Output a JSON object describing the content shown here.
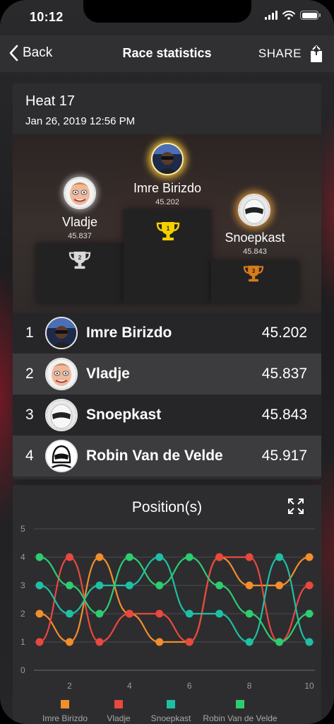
{
  "status": {
    "time": "10:12"
  },
  "nav": {
    "back_label": "Back",
    "title": "Race statistics",
    "share_label": "SHARE"
  },
  "heat": {
    "title": "Heat 17",
    "date": "Jan 26, 2019 12:56 PM"
  },
  "podium": [
    {
      "place": 1,
      "name": "Imre Birizdo",
      "time": "45.202",
      "trophy_color": "#f5d000"
    },
    {
      "place": 2,
      "name": "Vladje",
      "time": "45.837",
      "trophy_color": "#d9d9d9"
    },
    {
      "place": 3,
      "name": "Snoepkast",
      "time": "45.843",
      "trophy_color": "#d67c1c"
    }
  ],
  "ranking": [
    {
      "pos": "1",
      "name": "Imre Birizdo",
      "time": "45.202"
    },
    {
      "pos": "2",
      "name": "Vladje",
      "time": "45.837"
    },
    {
      "pos": "3",
      "name": "Snoepkast",
      "time": "45.843"
    },
    {
      "pos": "4",
      "name": "Robin Van de Velde",
      "time": "45.917"
    }
  ],
  "chart_data": {
    "type": "line",
    "title": "Position(s)",
    "x": [
      1,
      2,
      3,
      4,
      5,
      6,
      7,
      8,
      9,
      10
    ],
    "x_ticks": [
      "2",
      "4",
      "6",
      "8",
      "10"
    ],
    "y_ticks": [
      "0",
      "1",
      "2",
      "3",
      "4",
      "5"
    ],
    "ylim": [
      0,
      5
    ],
    "xlim": [
      1,
      10
    ],
    "grid": true,
    "legend_position": "bottom",
    "series": [
      {
        "name": "Imre Birizdo",
        "color": "#f28e2b",
        "values": [
          2,
          1,
          4,
          2,
          1,
          1,
          4,
          3,
          3,
          4
        ]
      },
      {
        "name": "Vladje",
        "color": "#e8483d",
        "values": [
          1,
          4,
          1,
          2,
          2,
          1,
          4,
          4,
          1,
          3
        ]
      },
      {
        "name": "Snoepkast",
        "color": "#1fbfa4",
        "values": [
          3,
          2,
          3,
          3,
          4,
          2,
          2,
          1,
          4,
          1
        ]
      },
      {
        "name": "Robin Van de Velde",
        "color": "#2ecc71",
        "values": [
          4,
          3,
          2,
          4,
          3,
          4,
          3,
          2,
          1,
          2
        ]
      }
    ]
  }
}
